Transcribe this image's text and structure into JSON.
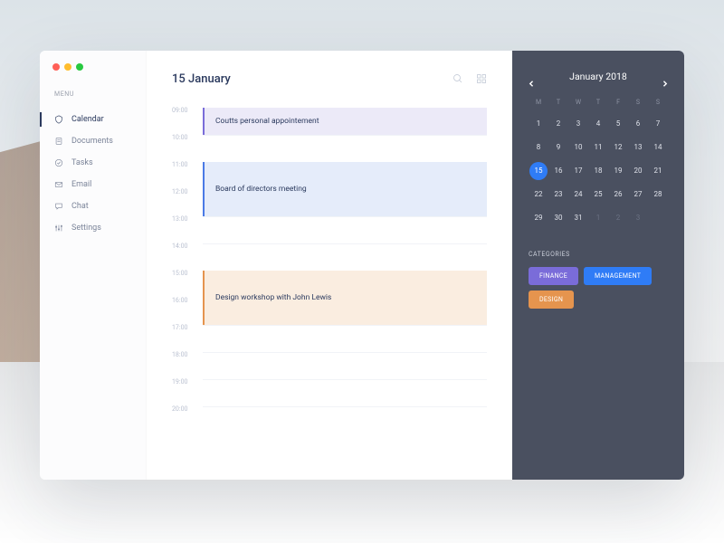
{
  "sidebar": {
    "menu_label": "MENU",
    "items": [
      {
        "label": "Calendar"
      },
      {
        "label": "Documents"
      },
      {
        "label": "Tasks"
      },
      {
        "label": "Email"
      },
      {
        "label": "Chat"
      },
      {
        "label": "Settings"
      }
    ]
  },
  "main": {
    "title": "15 January",
    "hours": [
      "09:00",
      "10:00",
      "11:00",
      "12:00",
      "13:00",
      "14:00",
      "15:00",
      "16:00",
      "17:00",
      "18:00",
      "19:00",
      "20:00"
    ],
    "events": [
      {
        "title": "Coutts personal appointement",
        "start": "09:00",
        "end": "10:00",
        "category": "finance"
      },
      {
        "title": "Board of directors meeting",
        "start": "11:00",
        "end": "13:00",
        "category": "management"
      },
      {
        "title": "Design workshop with John Lewis",
        "start": "15:00",
        "end": "17:00",
        "category": "design"
      }
    ]
  },
  "calendar": {
    "title": "January 2018",
    "dow": [
      "M",
      "T",
      "W",
      "T",
      "F",
      "S",
      "S"
    ],
    "days": [
      1,
      2,
      3,
      4,
      5,
      6,
      7,
      8,
      9,
      10,
      11,
      12,
      13,
      14,
      15,
      16,
      17,
      18,
      19,
      20,
      21,
      22,
      23,
      24,
      25,
      26,
      27,
      28,
      29,
      30,
      31
    ],
    "trailing": [
      1,
      2,
      3
    ],
    "selected": 15
  },
  "categories": {
    "label": "CATEGORIES",
    "items": [
      {
        "label": "FINANCE",
        "class": "cat-fin"
      },
      {
        "label": "MANAGEMENT",
        "class": "cat-mgmt"
      },
      {
        "label": "DESIGN",
        "class": "cat-des"
      }
    ]
  }
}
